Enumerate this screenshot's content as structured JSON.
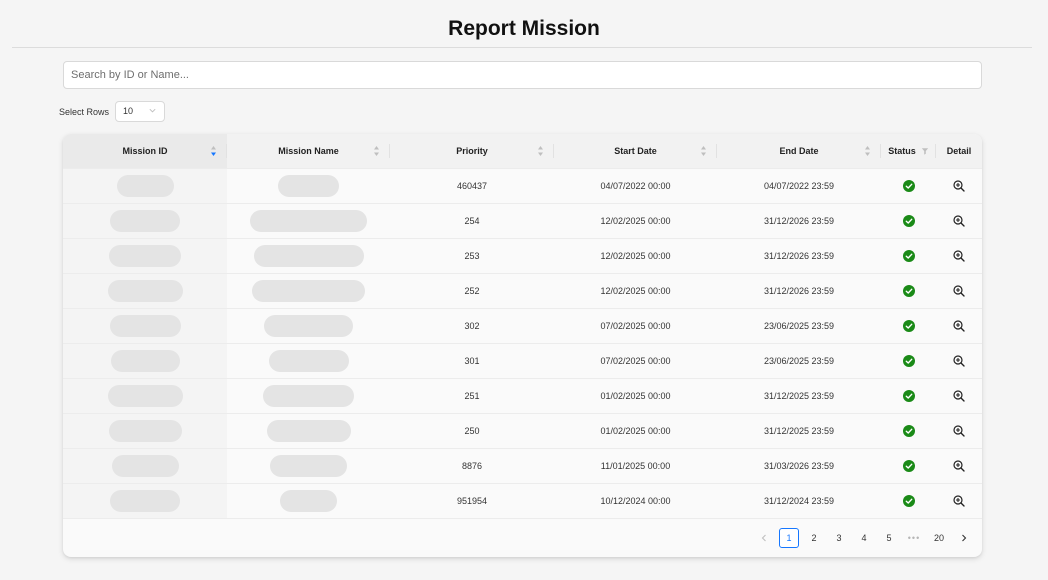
{
  "page": {
    "title": "Report Mission"
  },
  "search": {
    "placeholder": "Search by ID or Name..."
  },
  "rows_selector": {
    "label": "Select Rows",
    "value": "10"
  },
  "table": {
    "columns": [
      {
        "key": "mission_id",
        "label": "Mission ID",
        "sortable": true,
        "sorted": "desc"
      },
      {
        "key": "mission_name",
        "label": "Mission Name",
        "sortable": true
      },
      {
        "key": "priority",
        "label": "Priority",
        "sortable": true
      },
      {
        "key": "start_date",
        "label": "Start Date",
        "sortable": true
      },
      {
        "key": "end_date",
        "label": "End Date",
        "sortable": true
      },
      {
        "key": "status",
        "label": "Status",
        "filterable": true
      },
      {
        "key": "detail",
        "label": "Detail"
      }
    ],
    "rows": [
      {
        "priority": "460437",
        "start_date": "04/07/2022 00:00",
        "end_date": "04/07/2022 23:59",
        "status": "active"
      },
      {
        "priority": "254",
        "start_date": "12/02/2025 00:00",
        "end_date": "31/12/2026 23:59",
        "status": "active"
      },
      {
        "priority": "253",
        "start_date": "12/02/2025 00:00",
        "end_date": "31/12/2026 23:59",
        "status": "active"
      },
      {
        "priority": "252",
        "start_date": "12/02/2025 00:00",
        "end_date": "31/12/2026 23:59",
        "status": "active"
      },
      {
        "priority": "302",
        "start_date": "07/02/2025 00:00",
        "end_date": "23/06/2025 23:59",
        "status": "active"
      },
      {
        "priority": "301",
        "start_date": "07/02/2025 00:00",
        "end_date": "23/06/2025 23:59",
        "status": "active"
      },
      {
        "priority": "251",
        "start_date": "01/02/2025 00:00",
        "end_date": "31/12/2025 23:59",
        "status": "active"
      },
      {
        "priority": "250",
        "start_date": "01/02/2025 00:00",
        "end_date": "31/12/2025 23:59",
        "status": "active"
      },
      {
        "priority": "8876",
        "start_date": "11/01/2025 00:00",
        "end_date": "31/03/2026 23:59",
        "status": "active"
      },
      {
        "priority": "951954",
        "start_date": "10/12/2024 00:00",
        "end_date": "31/12/2024 23:59",
        "status": "active"
      }
    ]
  },
  "pagination": {
    "current": "1",
    "pages": [
      "1",
      "2",
      "3",
      "4",
      "5"
    ],
    "ellipsis": "•••",
    "last": "20"
  },
  "colors": {
    "status_active": "#1a8a17",
    "accent": "#1677ff",
    "sort_active": "#1677ff"
  },
  "icons": {
    "sort": "sort-icon",
    "filter": "filter-icon",
    "status": "check-circle-icon",
    "detail": "zoom-in-icon",
    "prev": "chevron-left-icon",
    "next": "chevron-right-icon"
  }
}
